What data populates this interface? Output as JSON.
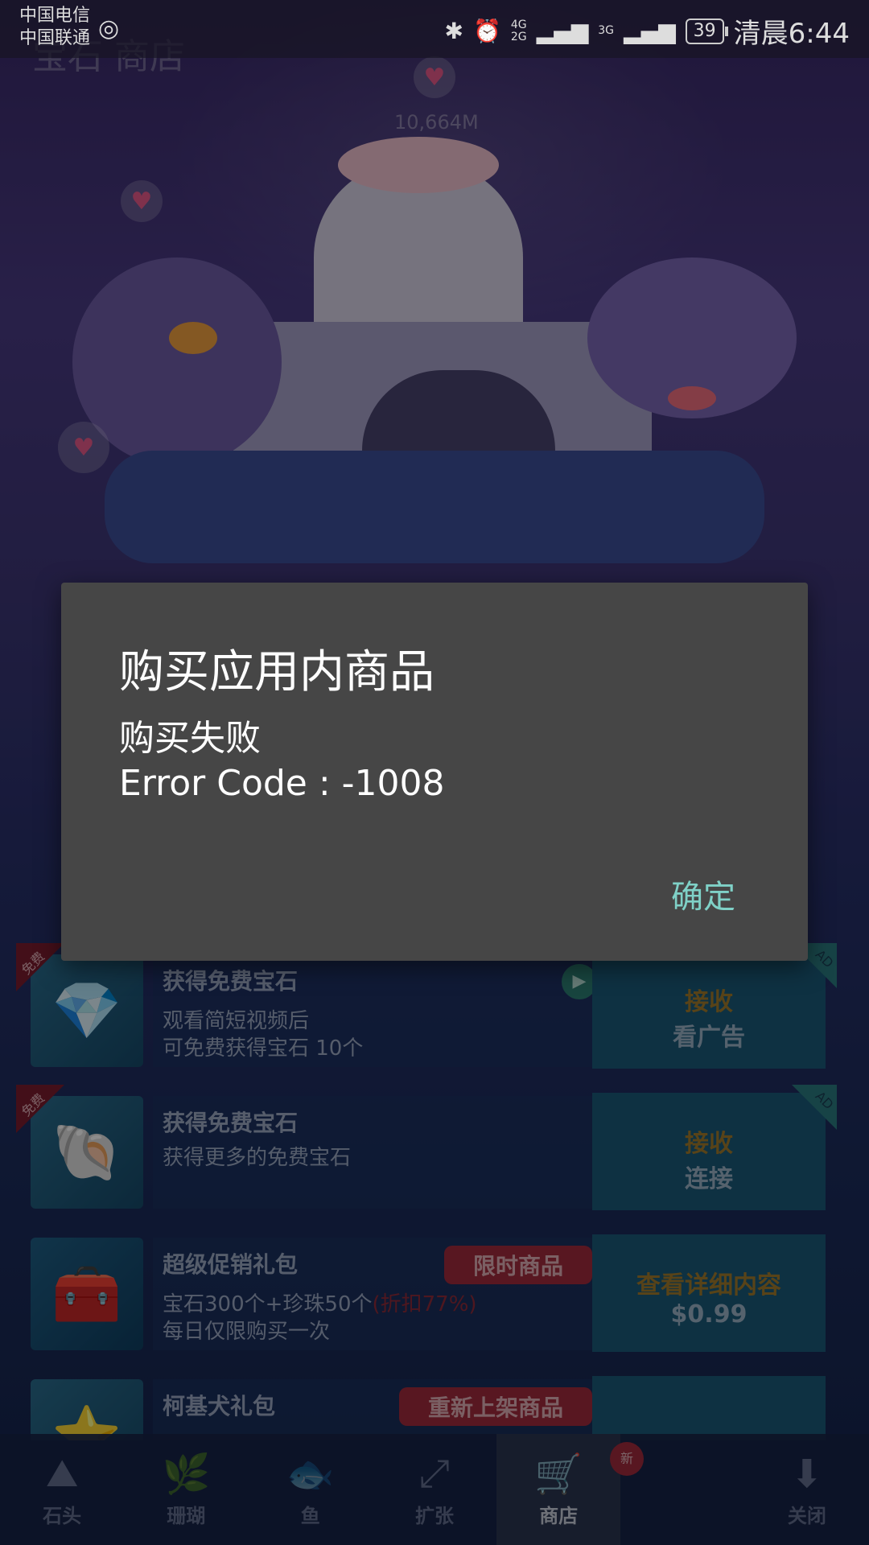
{
  "status_bar": {
    "carrier1": "中国电信",
    "carrier2": "中国联通",
    "net_top": "4G",
    "net_bottom": "2G",
    "net_3g": "3G",
    "battery": "39",
    "time": "清晨6:44"
  },
  "game": {
    "shop_title": "宝石 商店",
    "depth": "10,664M"
  },
  "shop": {
    "items": [
      {
        "ribbon": "免费",
        "title": "获得免费宝石",
        "desc1": "观看简短视频后",
        "desc2": "可免费获得宝石 10个",
        "action1": "接收",
        "action2": "看广告",
        "ad": "AD"
      },
      {
        "ribbon": "免费",
        "title": "获得免费宝石",
        "desc1": "获得更多的免费宝石",
        "desc2": "",
        "action1": "接收",
        "action2": "连接",
        "ad": "AD"
      },
      {
        "title": "超级促销礼包",
        "tag": "限时商品",
        "desc1": "宝石300个+珍珠50个",
        "discount": "(折扣77%)",
        "desc2": "每日仅限购买一次",
        "action1": "查看详细内容",
        "action2": "$0.99"
      },
      {
        "title": "柯基犬礼包",
        "tag": "重新上架商品"
      }
    ]
  },
  "nav": {
    "items": [
      "石头",
      "珊瑚",
      "鱼",
      "扩张",
      "商店",
      "关闭"
    ],
    "badge": "新"
  },
  "dialog": {
    "title": "购买应用内商品",
    "message_line1": "购买失败",
    "message_line2": "Error Code : -1008",
    "ok_label": "确定"
  },
  "colors": {
    "dialog_bg": "#464646",
    "ok_accent": "#7fd1c7",
    "tag_red": "#a12b3c"
  }
}
